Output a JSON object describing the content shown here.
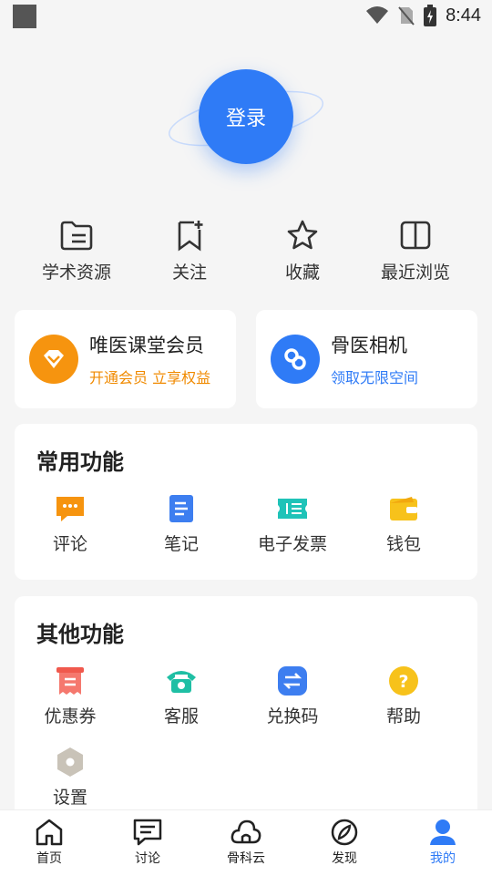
{
  "status_bar": {
    "time": "8:44"
  },
  "login": {
    "label": "登录"
  },
  "shortcuts": [
    {
      "label": "学术资源",
      "icon": "folder-icon"
    },
    {
      "label": "关注",
      "icon": "bookmark-plus-icon"
    },
    {
      "label": "收藏",
      "icon": "star-icon"
    },
    {
      "label": "最近浏览",
      "icon": "book-icon"
    }
  ],
  "cards": [
    {
      "title": "唯医课堂会员",
      "subtitle": "开通会员 立享权益",
      "subtitle_color": "#f08a00",
      "icon": "diamond-icon"
    },
    {
      "title": "骨医相机",
      "subtitle": "领取无限空间",
      "subtitle_color": "#2f7bf6",
      "icon": "camera-link-icon"
    }
  ],
  "common": {
    "title": "常用功能",
    "items": [
      {
        "label": "评论",
        "icon": "comment-icon"
      },
      {
        "label": "笔记",
        "icon": "note-icon"
      },
      {
        "label": "电子发票",
        "icon": "invoice-icon"
      },
      {
        "label": "钱包",
        "icon": "wallet-icon"
      }
    ]
  },
  "other": {
    "title": "其他功能",
    "items": [
      {
        "label": "优惠券",
        "icon": "coupon-icon"
      },
      {
        "label": "客服",
        "icon": "phone-icon"
      },
      {
        "label": "兑换码",
        "icon": "exchange-icon"
      },
      {
        "label": "帮助",
        "icon": "help-icon"
      },
      {
        "label": "设置",
        "icon": "settings-icon"
      }
    ]
  },
  "tabs": [
    {
      "label": "首页",
      "icon": "home-icon"
    },
    {
      "label": "讨论",
      "icon": "discussion-icon"
    },
    {
      "label": "骨科云",
      "icon": "cloud-icon"
    },
    {
      "label": "发现",
      "icon": "compass-icon"
    },
    {
      "label": "我的",
      "icon": "profile-icon",
      "active": true
    }
  ],
  "colors": {
    "accent": "#2f7bf6",
    "vip": "#f08a00"
  }
}
